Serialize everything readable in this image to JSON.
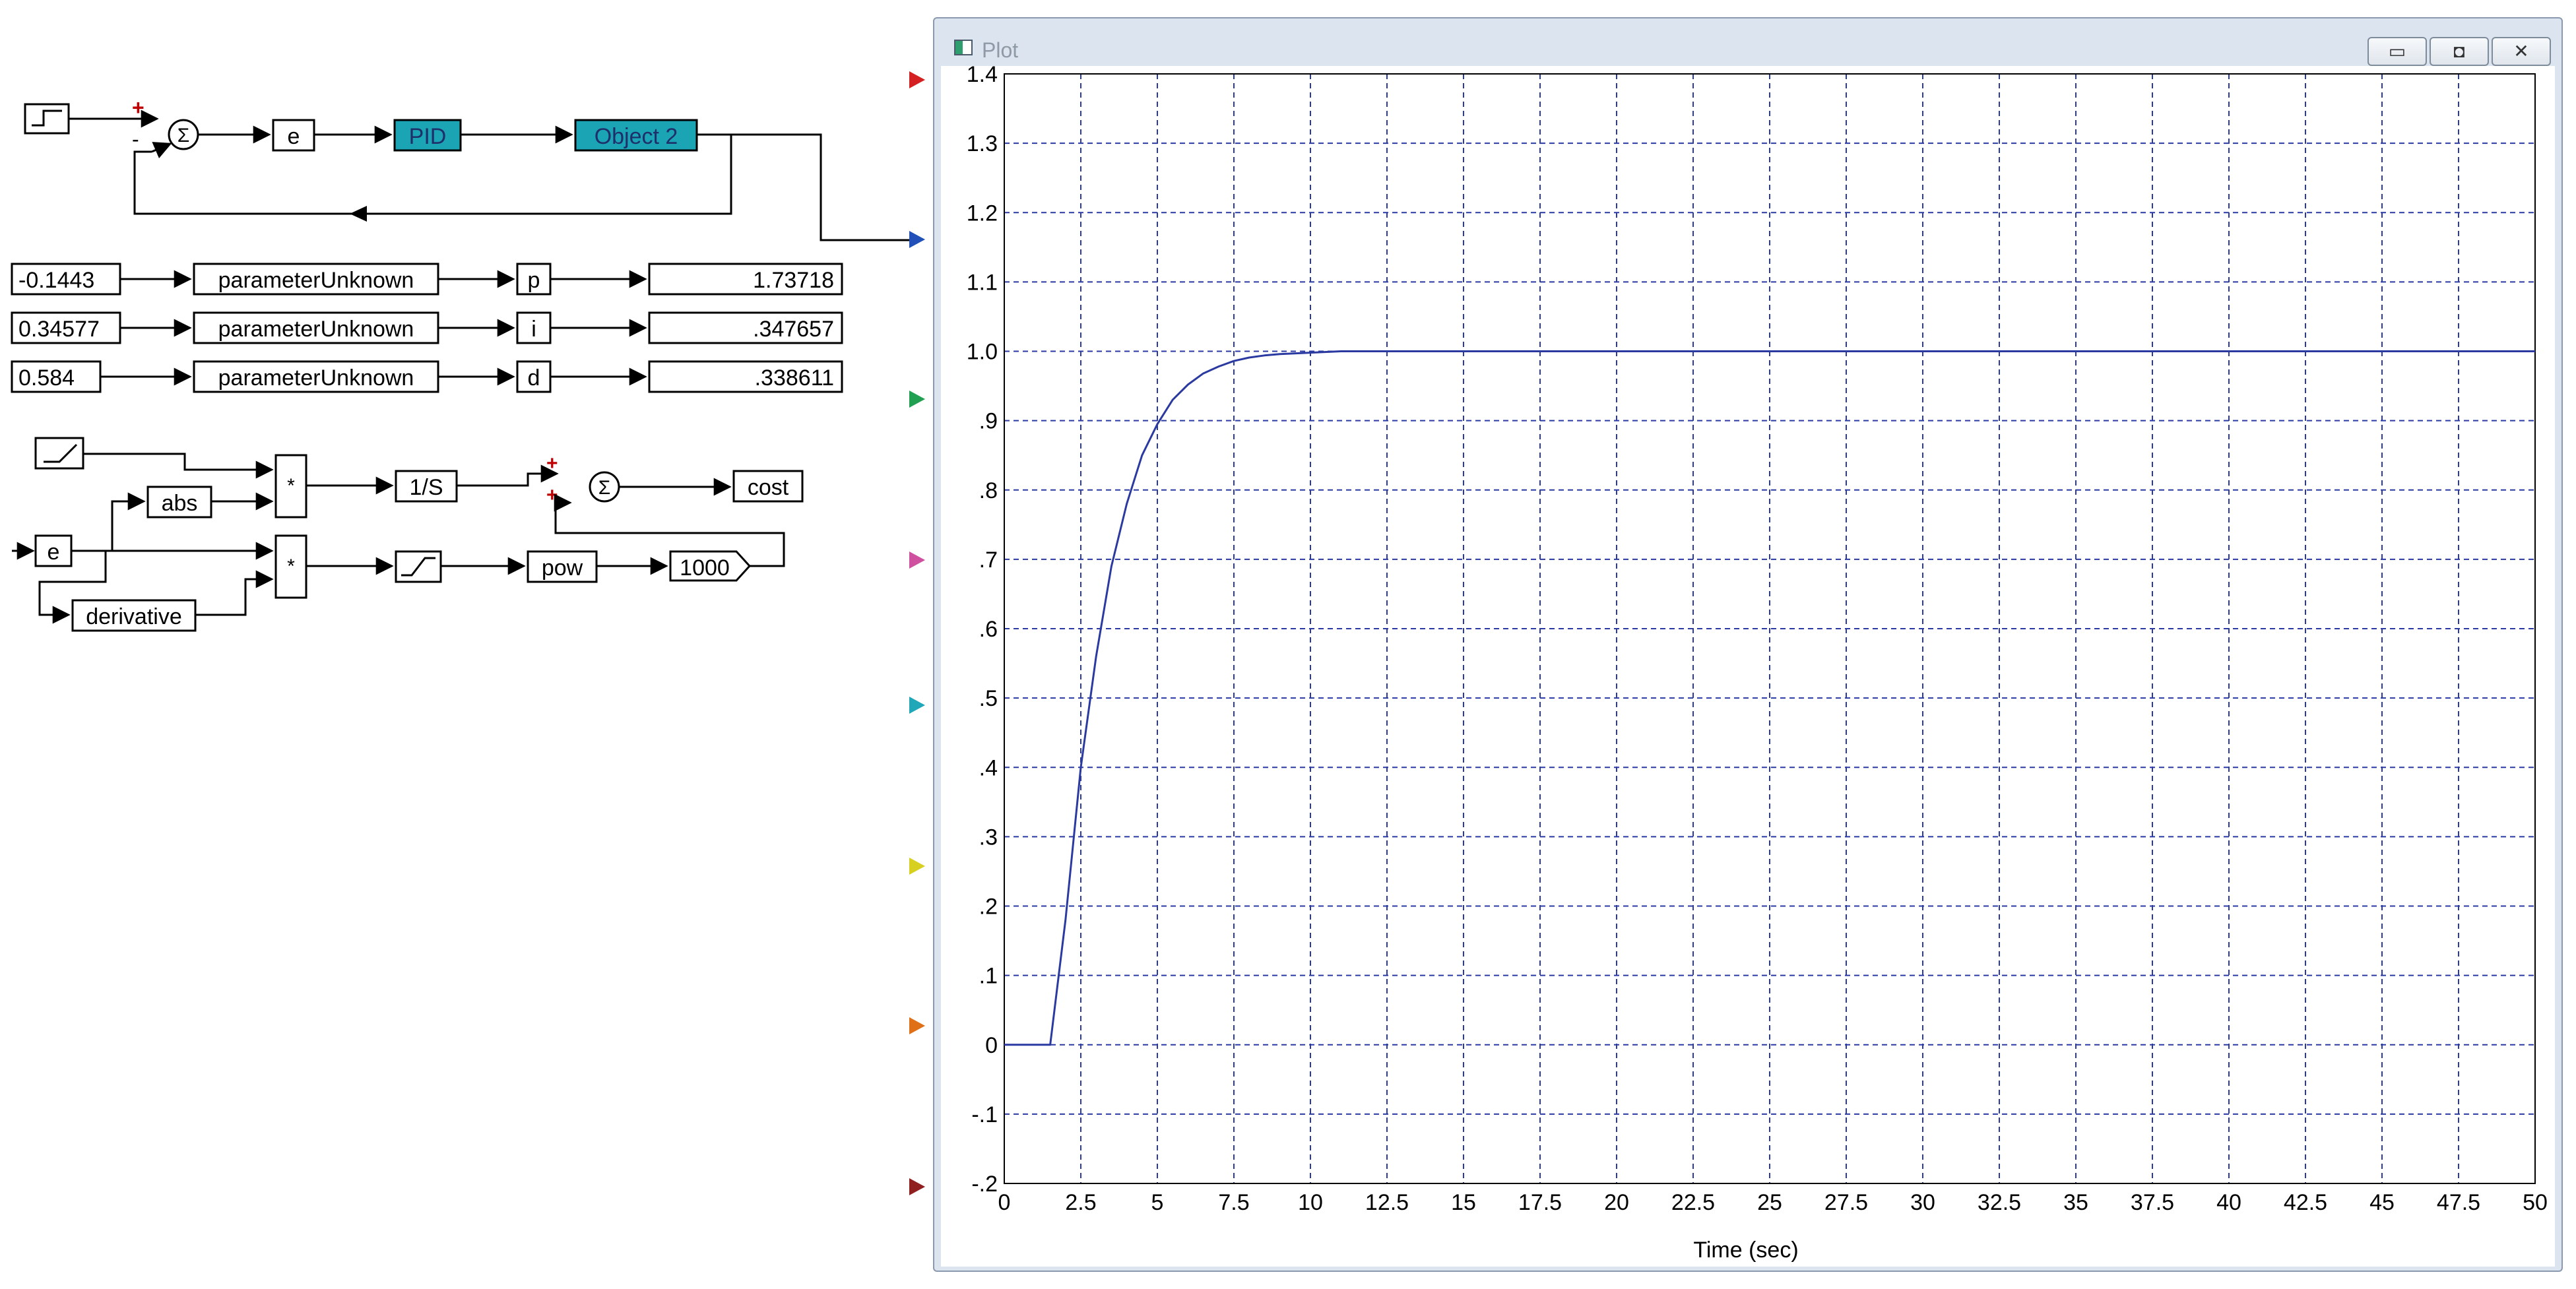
{
  "diagram": {
    "loop": {
      "error_label": "e",
      "controller_label": "PID",
      "plant_label": "Object 2",
      "plus_sign": "+",
      "minus_sign": "-",
      "sum_symbol": "Σ"
    },
    "parameters": [
      {
        "initial": "-0.1443",
        "block": "parameterUnknown",
        "name": "p",
        "display": "1.73718"
      },
      {
        "initial": "0.34577",
        "block": "parameterUnknown",
        "name": "i",
        "display": ".347657"
      },
      {
        "initial": "0.584",
        "block": "parameterUnknown",
        "name": "d",
        "display": ".338611"
      }
    ],
    "cost": {
      "abs_label": "abs",
      "error_label": "e",
      "derivative_label": "derivative",
      "multiply_symbol": "*",
      "integrator_label": "1/S",
      "pow_label": "pow",
      "constant_label": "1000",
      "output_label": "cost",
      "sum_symbol": "Σ",
      "plus_sign": "+"
    },
    "input_pin_colors": [
      "#d42020",
      "#2050b8",
      "#20a050",
      "#d050a0",
      "#20a8b8",
      "#d8d020",
      "#e07018",
      "#902020"
    ]
  },
  "window": {
    "title": "Plot",
    "minimize_icon": "▭",
    "maximize_icon": "◘",
    "close_icon": "✕"
  },
  "chart_data": {
    "type": "line",
    "title": "",
    "xlabel": "Time (sec)",
    "ylabel": "",
    "xlim": [
      0,
      50
    ],
    "ylim": [
      -0.2,
      1.4
    ],
    "grid": true,
    "x_tick_labels": [
      "0",
      "2.5",
      "5",
      "7.5",
      "10",
      "12.5",
      "15",
      "17.5",
      "20",
      "22.5",
      "25",
      "27.5",
      "30",
      "32.5",
      "35",
      "37.5",
      "40",
      "42.5",
      "45",
      "47.5",
      "50"
    ],
    "y_tick_labels": [
      "1.4",
      "1.3",
      "1.2",
      "1.1",
      "1.0",
      ".9",
      ".8",
      ".7",
      ".6",
      ".5",
      ".4",
      ".3",
      ".2",
      ".1",
      "0",
      "-.1",
      "-.2"
    ],
    "series": [
      {
        "color": "#2b3aa0",
        "x": [
          0,
          1.5,
          2.0,
          2.5,
          3.0,
          3.5,
          4.0,
          4.5,
          5.0,
          5.5,
          6.0,
          6.5,
          7.0,
          7.5,
          8.0,
          8.5,
          9.0,
          10.0,
          11.0,
          12.5,
          15,
          20,
          25,
          30,
          35,
          40,
          45,
          50
        ],
        "y": [
          0,
          0,
          0.18,
          0.4,
          0.56,
          0.69,
          0.78,
          0.85,
          0.895,
          0.93,
          0.952,
          0.968,
          0.978,
          0.986,
          0.991,
          0.994,
          0.996,
          0.998,
          1.0,
          1.0,
          1.0,
          1.0,
          1.0,
          1.0,
          1.0,
          1.0,
          1.0,
          1.0
        ]
      }
    ]
  }
}
